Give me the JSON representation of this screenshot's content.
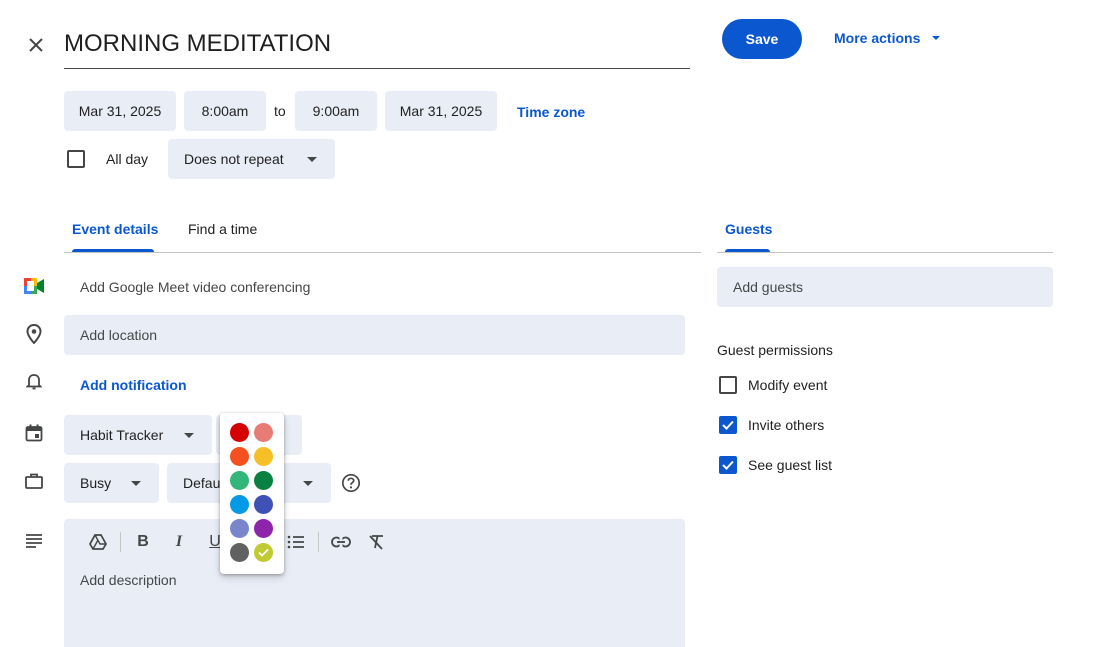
{
  "header": {
    "title": "MORNING MEDITATION",
    "save_label": "Save",
    "more_actions_label": "More actions"
  },
  "datetime": {
    "start_date": "Mar 31, 2025",
    "start_time": "8:00am",
    "to_label": "to",
    "end_time": "9:00am",
    "end_date": "Mar 31, 2025",
    "timezone_label": "Time zone",
    "all_day_label": "All day",
    "repeat_value": "Does not repeat"
  },
  "tabs": {
    "event_details": "Event details",
    "find_time": "Find a time",
    "guests": "Guests"
  },
  "details": {
    "meet_label": "Add Google Meet video conferencing",
    "location_placeholder": "Add location",
    "notification_label": "Add notification",
    "calendar_value": "Habit Tracker",
    "availability_value": "Busy",
    "visibility_value_partial": "Defau",
    "description_placeholder": "Add description"
  },
  "guests": {
    "add_placeholder": "Add guests",
    "permissions_title": "Guest permissions",
    "modify_event": "Modify event",
    "invite_others": "Invite others",
    "see_guest_list": "See guest list"
  },
  "color_palette": {
    "colors": [
      "#d50000",
      "#e67c73",
      "#f4511e",
      "#f6bf26",
      "#33b679",
      "#0b8043",
      "#039be5",
      "#3f51b5",
      "#7986cb",
      "#8e24aa",
      "#616161",
      "#c0ca33"
    ],
    "selected_index": 11
  },
  "toolbar_glyphs": {
    "bold": "B",
    "italic": "I",
    "underline": "U"
  }
}
